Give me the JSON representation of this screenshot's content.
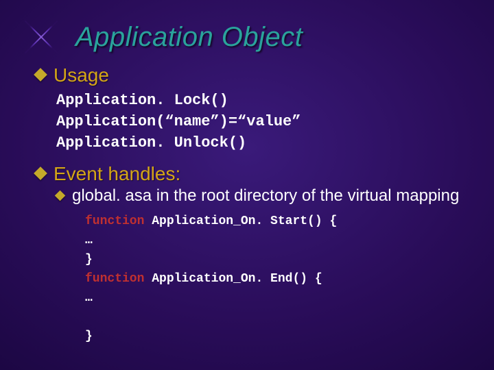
{
  "title": "Application Object",
  "bullets": {
    "usage": "Usage",
    "event": "Event handles:",
    "global": "global. asa in the root directory of the virtual mapping"
  },
  "code_usage": "Application. Lock()\nApplication(“name”)=“value”\nApplication. Unlock()",
  "code_event": {
    "kw": "function",
    "fn1": " Application_On. Start() {",
    "ell": "…",
    "close": "}",
    "fn2": " Application_On. End() {"
  }
}
